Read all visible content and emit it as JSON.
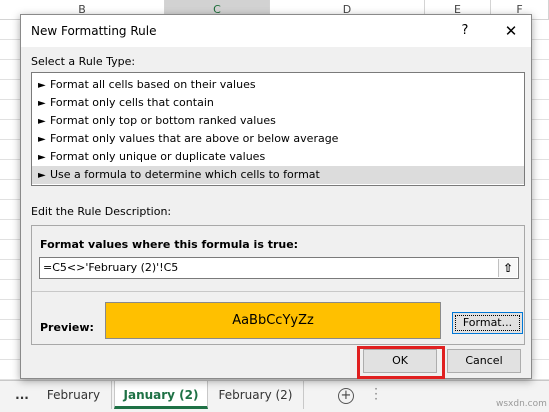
{
  "excel": {
    "columns": [
      {
        "label": "B",
        "selected": false
      },
      {
        "label": "C",
        "selected": true
      },
      {
        "label": "D",
        "selected": false
      },
      {
        "label": "E",
        "selected": false
      },
      {
        "label": "F",
        "selected": false
      }
    ]
  },
  "sheet_tabs": {
    "more": "...",
    "tabs": [
      {
        "label": "February",
        "active": false
      },
      {
        "label": "January (2)",
        "active": true
      },
      {
        "label": "February (2)",
        "active": false
      }
    ],
    "add_icon": "plus-circle-icon",
    "options_icon": "vertical-dots-icon"
  },
  "dialog": {
    "title": "New Formatting Rule",
    "help_label": "?",
    "close_label": "✕",
    "rule_type_label": "Select a Rule Type:",
    "rule_types": [
      {
        "label": "Format all cells based on their values",
        "selected": false
      },
      {
        "label": "Format only cells that contain",
        "selected": false
      },
      {
        "label": "Format only top or bottom ranked values",
        "selected": false
      },
      {
        "label": "Format only values that are above or below average",
        "selected": false
      },
      {
        "label": "Format only unique or duplicate values",
        "selected": false
      },
      {
        "label": "Use a formula to determine which cells to format",
        "selected": true
      }
    ],
    "rule_arrow": "►",
    "edit_label": "Edit the Rule Description:",
    "formula_label": "Format values where this formula is true:",
    "formula_value": "=C5<>'February (2)'!C5",
    "collapse_icon": "collapse-dialog-icon",
    "preview_label": "Preview:",
    "preview_text": "AaBbCcYyZz",
    "preview_fill": "#ffc000",
    "format_button": "Format...",
    "ok_button": "OK",
    "cancel_button": "Cancel",
    "highlight_color": "#e02020"
  },
  "watermark": "wsxdn.com"
}
